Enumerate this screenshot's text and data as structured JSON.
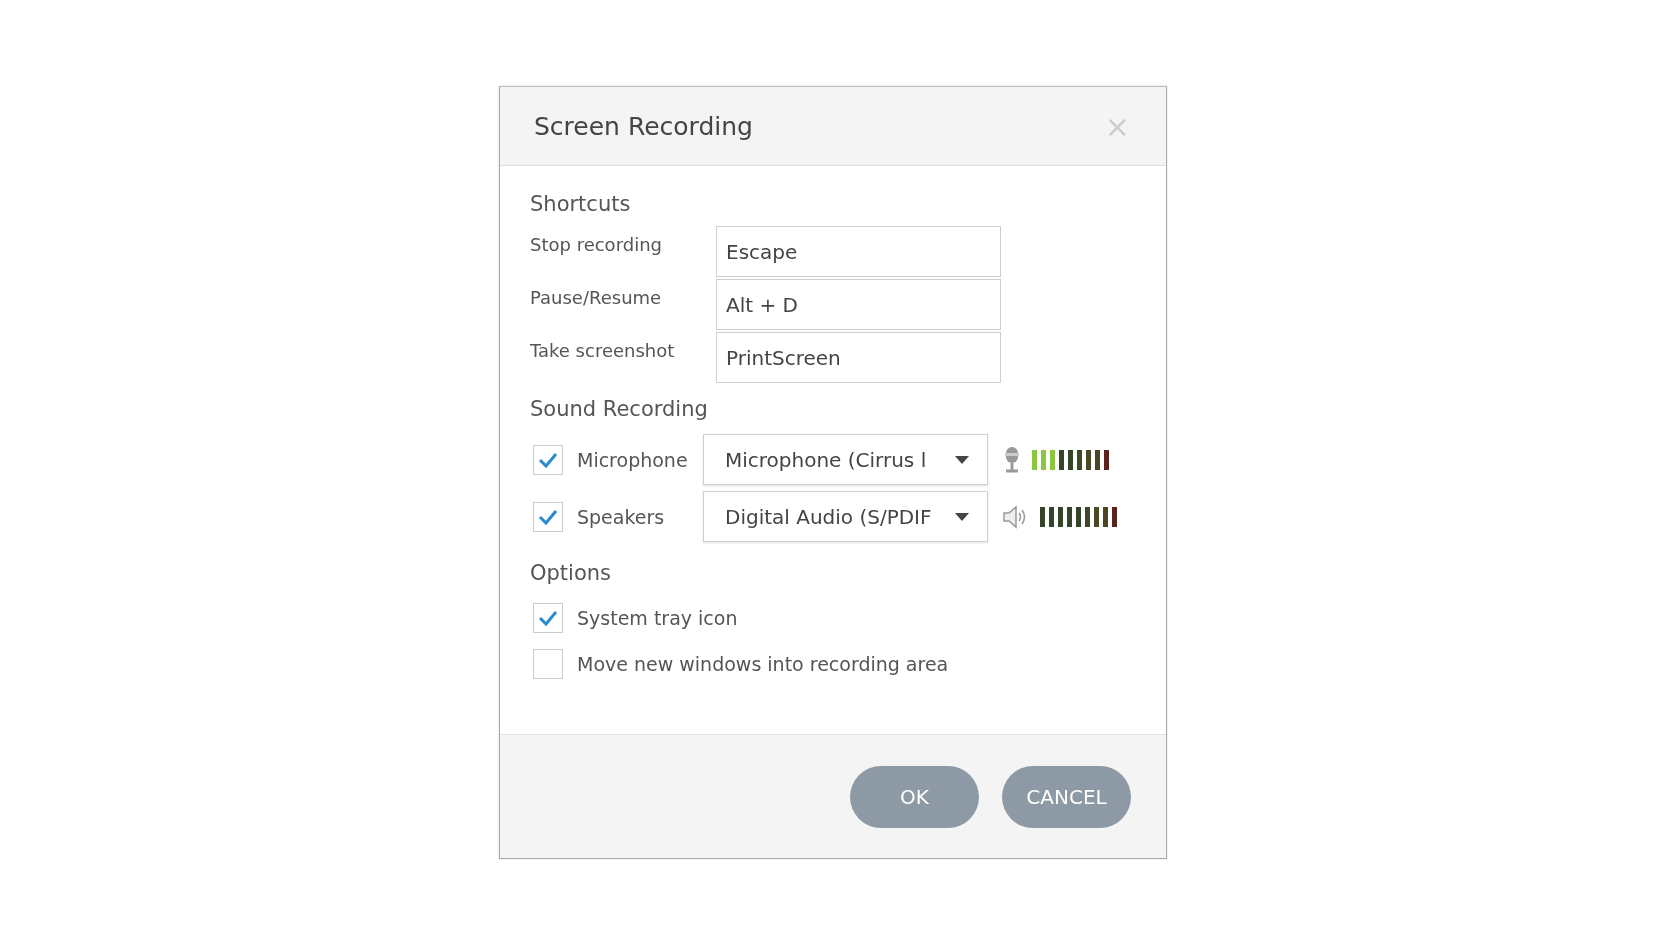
{
  "dialog": {
    "title": "Screen Recording",
    "close": "×"
  },
  "shortcuts": {
    "heading": "Shortcuts",
    "rows": [
      {
        "label": "Stop recording",
        "value": "Escape"
      },
      {
        "label": "Pause/Resume",
        "value": "Alt + D"
      },
      {
        "label": "Take screenshot",
        "value": "PrintScreen"
      }
    ]
  },
  "sound": {
    "heading": "Sound Recording",
    "rows": [
      {
        "kind": "microphone",
        "label": "Microphone",
        "checked": true,
        "device": "Microphone (Cirrus l",
        "meter": [
          {
            "lit": true
          },
          {
            "lit": true
          },
          {
            "lit": true
          },
          {
            "lit": false
          },
          {
            "lit": false
          },
          {
            "lit": false
          },
          {
            "lit": false
          },
          {
            "lit": false
          },
          {
            "lit": false
          }
        ]
      },
      {
        "kind": "speaker",
        "label": "Speakers",
        "checked": true,
        "device": "Digital Audio (S/PDIF",
        "meter": [
          {
            "lit": false
          },
          {
            "lit": false
          },
          {
            "lit": false
          },
          {
            "lit": false
          },
          {
            "lit": false
          },
          {
            "lit": false
          },
          {
            "lit": false
          },
          {
            "lit": false
          },
          {
            "lit": false
          }
        ]
      }
    ]
  },
  "options": {
    "heading": "Options",
    "items": [
      {
        "label": "System tray icon",
        "checked": true
      },
      {
        "label": "Move new windows into recording area",
        "checked": false
      }
    ]
  },
  "buttons": [
    "OK",
    "CANCEL"
  ]
}
